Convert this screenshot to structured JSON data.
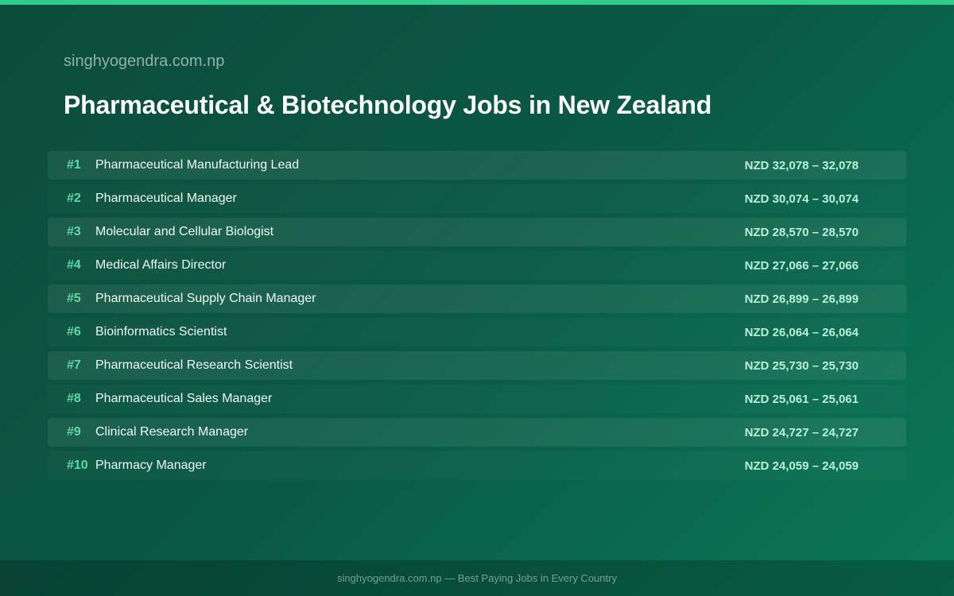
{
  "site": "singhyogendra.com.np",
  "title": "Pharmaceutical & Biotechnology Jobs in New Zealand",
  "jobs": [
    {
      "rank": "#1",
      "title": "Pharmaceutical Manufacturing Lead",
      "salary": "NZD 32,078 – 32,078"
    },
    {
      "rank": "#2",
      "title": "Pharmaceutical Manager",
      "salary": "NZD 30,074 – 30,074"
    },
    {
      "rank": "#3",
      "title": "Molecular and Cellular Biologist",
      "salary": "NZD 28,570 – 28,570"
    },
    {
      "rank": "#4",
      "title": "Medical Affairs Director",
      "salary": "NZD 27,066 – 27,066"
    },
    {
      "rank": "#5",
      "title": "Pharmaceutical Supply Chain Manager",
      "salary": "NZD 26,899 – 26,899"
    },
    {
      "rank": "#6",
      "title": "Bioinformatics Scientist",
      "salary": "NZD 26,064 – 26,064"
    },
    {
      "rank": "#7",
      "title": "Pharmaceutical Research Scientist",
      "salary": "NZD 25,730 – 25,730"
    },
    {
      "rank": "#8",
      "title": "Pharmaceutical Sales Manager",
      "salary": "NZD 25,061 – 25,061"
    },
    {
      "rank": "#9",
      "title": "Clinical Research Manager",
      "salary": "NZD 24,727 – 24,727"
    },
    {
      "rank": "#10",
      "title": "Pharmacy Manager",
      "salary": "NZD 24,059 – 24,059"
    }
  ],
  "footer": "singhyogendra.com.np — Best Paying Jobs in Every Country",
  "colors": {
    "accent": "#2ecc8f",
    "rank": "#5fd8a6",
    "salary": "#b8f0d8",
    "background_start": "#0c4b3a",
    "background_end": "#0b7857"
  }
}
